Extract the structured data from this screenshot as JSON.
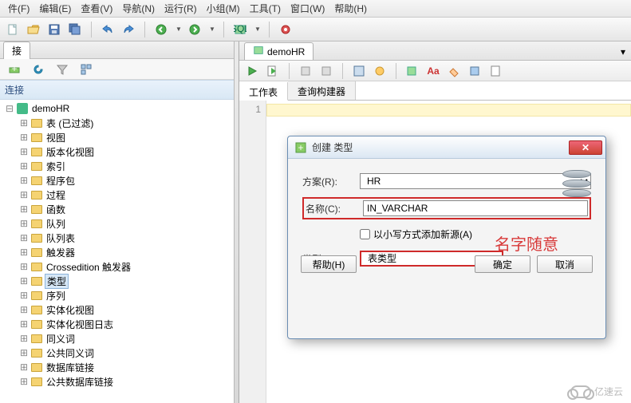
{
  "menubar": [
    "件(F)",
    "编辑(E)",
    "查看(V)",
    "导航(N)",
    "运行(R)",
    "小组(M)",
    "工具(T)",
    "窗口(W)",
    "帮助(H)"
  ],
  "left": {
    "tab": "接",
    "header": "连接",
    "root": "demoHR",
    "items": [
      "表 (已过滤)",
      "视图",
      "版本化视图",
      "索引",
      "程序包",
      "过程",
      "函数",
      "队列",
      "队列表",
      "触发器",
      "Crossedition 触发器",
      "类型",
      "序列",
      "实体化视图",
      "实体化视图日志",
      "同义词",
      "公共同义词",
      "数据库链接",
      "公共数据库链接"
    ],
    "selectedIndex": 11
  },
  "right": {
    "tab": "demoHR",
    "ws_tabs": [
      "工作表",
      "查询构建器"
    ],
    "active_ws": 0,
    "gutter": "1"
  },
  "dialog": {
    "title": "创建 类型",
    "scheme_label": "方案(R):",
    "scheme_value": "HR",
    "name_label": "名称(C):",
    "name_value": "IN_VARCHAR",
    "lowercase_label": "以小写方式添加新源(A)",
    "lowercase_checked": false,
    "type_label": "类型(T):",
    "type_value": "表类型",
    "help": "帮助(H)",
    "ok": "确定",
    "cancel": "取消"
  },
  "annotation": "名字随意",
  "watermark": "亿速云"
}
